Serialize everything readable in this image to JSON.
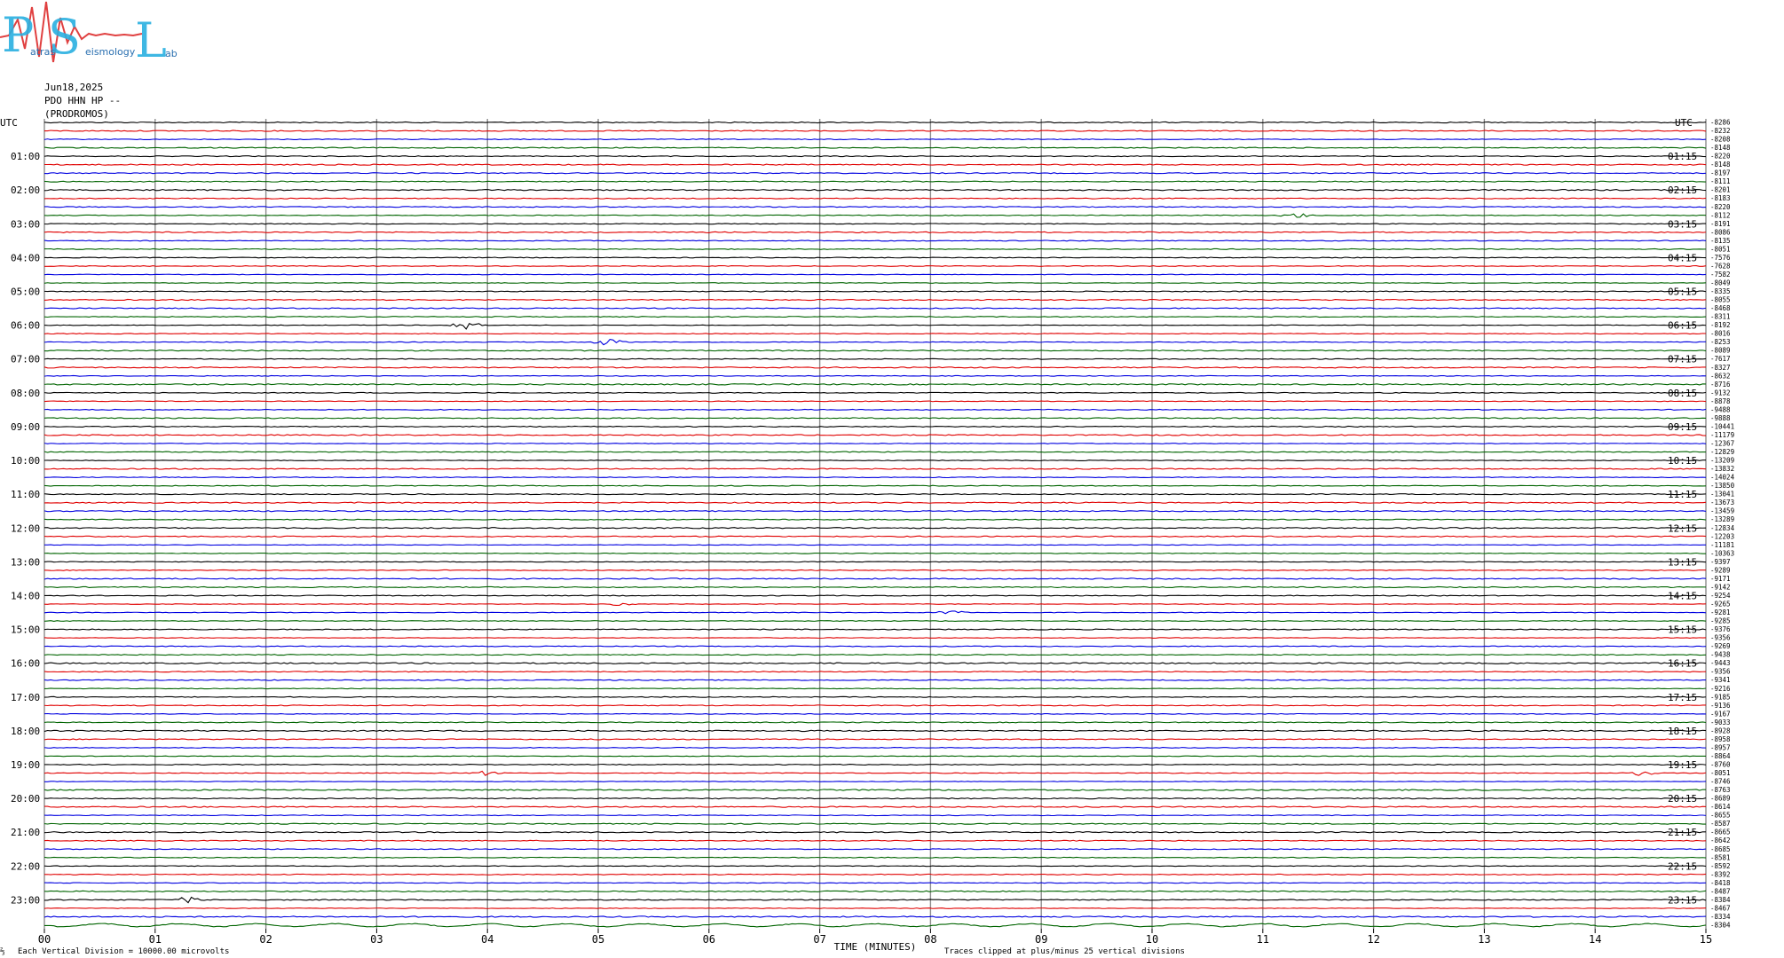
{
  "logo": {
    "letters": [
      "P",
      "S",
      "L"
    ],
    "small_words": [
      "atras",
      "eismology",
      "ab"
    ]
  },
  "header": {
    "date": "Jun18,2025",
    "station": "PDO HHN HP --",
    "site": "(PRODROMOS)"
  },
  "utc_label": "UTC",
  "chart_data": {
    "type": "line",
    "title": "",
    "xlabel": "TIME (MINUTES)",
    "x_ticks": [
      "00",
      "01",
      "02",
      "03",
      "04",
      "05",
      "06",
      "07",
      "08",
      "09",
      "10",
      "11",
      "12",
      "13",
      "14",
      "15"
    ],
    "xlim": [
      0,
      15
    ],
    "left_hour_labels": [
      "01:00",
      "02:00",
      "03:00",
      "04:00",
      "05:00",
      "06:00",
      "07:00",
      "08:00",
      "09:00",
      "10:00",
      "11:00",
      "12:00",
      "13:00",
      "14:00",
      "15:00",
      "16:00",
      "17:00",
      "18:00",
      "19:00",
      "20:00",
      "21:00",
      "22:00",
      "23:00"
    ],
    "right_hour_labels": [
      "01:15",
      "02:15",
      "03:15",
      "04:15",
      "05:15",
      "06:15",
      "07:15",
      "08:15",
      "09:15",
      "10:15",
      "11:15",
      "12:15",
      "13:15",
      "14:15",
      "15:15",
      "16:15",
      "17:15",
      "18:15",
      "19:15",
      "20:15",
      "21:15",
      "22:15",
      "23:15"
    ],
    "trace_colors": [
      "#000000",
      "#e00000",
      "#0000e0",
      "#006400"
    ],
    "trace_offsets": [
      "-8286",
      "-8232",
      "-8208",
      "-8148",
      "-8220",
      "-8148",
      "-8197",
      "-8111",
      "-8201",
      "-8183",
      "-8220",
      "-8112",
      "-8191",
      "-8086",
      "-8135",
      "-8051",
      "-7576",
      "-7628",
      "-7582",
      "-8049",
      "-8335",
      "-8055",
      "-8468",
      "-8311",
      "-8192",
      "-8016",
      "-8253",
      "-8089",
      "-7617",
      "-8327",
      "-8632",
      "-8716",
      "-9132",
      "-8878",
      "-9488",
      "-9888",
      "-10441",
      "-11179",
      "-12367",
      "-12829",
      "-13209",
      "-13832",
      "-14024",
      "-13850",
      "-13041",
      "-13673",
      "-13459",
      "-13289",
      "-12834",
      "-12203",
      "-11181",
      "-10363",
      "-9397",
      "-9289",
      "-9171",
      "-9142",
      "-9254",
      "-9265",
      "-9281",
      "-9285",
      "-9376",
      "-9356",
      "-9269",
      "-9438",
      "-9443",
      "-9356",
      "-9341",
      "-9216",
      "-9185",
      "-9136",
      "-9167",
      "-9033",
      "-8928",
      "-8958",
      "-8957",
      "-8864",
      "-8760",
      "-8051",
      "-8746",
      "-8763",
      "-8689",
      "-8614",
      "-8655",
      "-8587",
      "-8665",
      "-8642",
      "-8685",
      "-8581",
      "-8592",
      "-8392",
      "-8418",
      "-8487",
      "-8384",
      "-8467",
      "-8334",
      "-8304"
    ],
    "events": [
      {
        "trace": 24,
        "minute": 3.8,
        "amp": 6
      },
      {
        "trace": 26,
        "minute": 5.1,
        "amp": 4
      },
      {
        "trace": 11,
        "minute": 11.3,
        "amp": 3
      },
      {
        "trace": 57,
        "minute": 5.2,
        "amp": 3
      },
      {
        "trace": 58,
        "minute": 8.2,
        "amp": 3
      },
      {
        "trace": 77,
        "minute": 4.0,
        "amp": 3
      },
      {
        "trace": 77,
        "minute": 14.4,
        "amp": 4
      },
      {
        "trace": 92,
        "minute": 1.3,
        "amp": 4
      }
    ]
  },
  "footer": {
    "vertical_division": "Each Vertical Division = 10000.00 microvolts",
    "clip_note": "Traces clipped at plus/minus 25 vertical divisions"
  }
}
